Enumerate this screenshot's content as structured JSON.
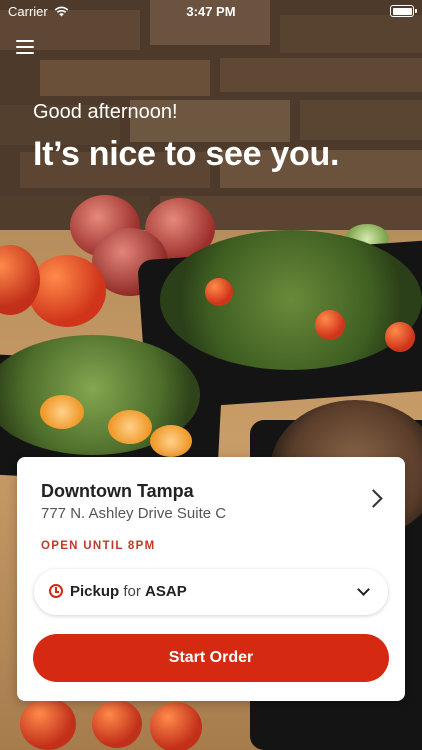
{
  "status_bar": {
    "carrier": "Carrier",
    "time": "3:47 PM"
  },
  "icons": {
    "menu": "hamburger-menu-icon",
    "wifi": "wifi-icon",
    "battery": "battery-icon",
    "location_chevron": "chevron-right-icon",
    "clock": "clock-icon",
    "dropdown_chevron": "chevron-down-icon"
  },
  "hero": {
    "greeting": "Good afternoon!",
    "headline": "It’s nice to see you."
  },
  "location": {
    "name": "Downtown Tampa",
    "address": "777 N. Ashley Drive Suite C",
    "hours": "OPEN UNTIL 8PM"
  },
  "order_mode": {
    "method": "Pickup",
    "connector": "for",
    "time": "ASAP"
  },
  "cta": {
    "label": "Start Order"
  },
  "colors": {
    "accent": "#d62912",
    "hours_text": "#c0392b"
  }
}
